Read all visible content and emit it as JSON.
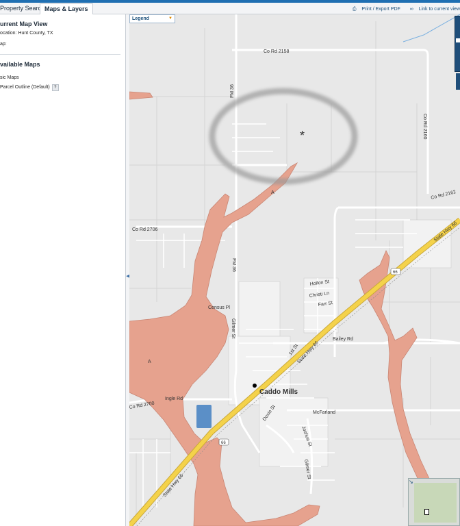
{
  "tabs": {
    "property_search": "Property Search",
    "maps_layers": "Maps & Layers"
  },
  "toolbar": {
    "print_label": "Print / Export PDF",
    "link_label": "Link to current view"
  },
  "panel": {
    "current_title": "urrent Map View",
    "location": "ocation: Hunt County, TX",
    "map": "ap:",
    "available_title": "vailable Maps",
    "basic_maps": "sic Maps",
    "parcel_outline": "Parcel Outline (Default)",
    "help": "?"
  },
  "map": {
    "legend_label": "Legend",
    "labels": {
      "co_rd_2158": "Co Rd 2158",
      "co_rd_2160": "Co Rd 2160",
      "co_rd_2162": "Co Rd 2162",
      "co_rd_2706": "Co Rd 2706",
      "co_rd_2700": "Co Rd 2700",
      "fm_36_upper": "FM 36",
      "fm_36_lower": "FM 36",
      "state_hwy_66_upper": "State Hwy 66",
      "state_hwy_66_center": "State Hwy 66",
      "state_hwy_66_lower": "State Hwy 66",
      "hwy_shield": "66",
      "hwy_shield_lower": "66",
      "hollon_st": "Hollon St",
      "christi_ln": "Christi Ln",
      "farr_st": "Farr St",
      "census_pl": "Census Pl",
      "gilmer_st_upper": "Gilmer St",
      "gilmer_st_lower": "Gilmer St",
      "bailey_rd": "Bailey Rd",
      "first_st": "1st St",
      "doxie_st": "Doxie St",
      "joshua_st": "Joshua St",
      "mcfarland": "McFarland",
      "ingle_rd": "Ingle Rd",
      "town": "Caddo Mills",
      "zone_a1": "A",
      "zone_a2": "A",
      "marker": "*"
    }
  },
  "colors": {
    "flood_zone": "#e6a28e",
    "flood_edge": "#c98674",
    "highway": "#f4d24a",
    "water": "#5b8fc7",
    "marker": "#cc0000"
  }
}
